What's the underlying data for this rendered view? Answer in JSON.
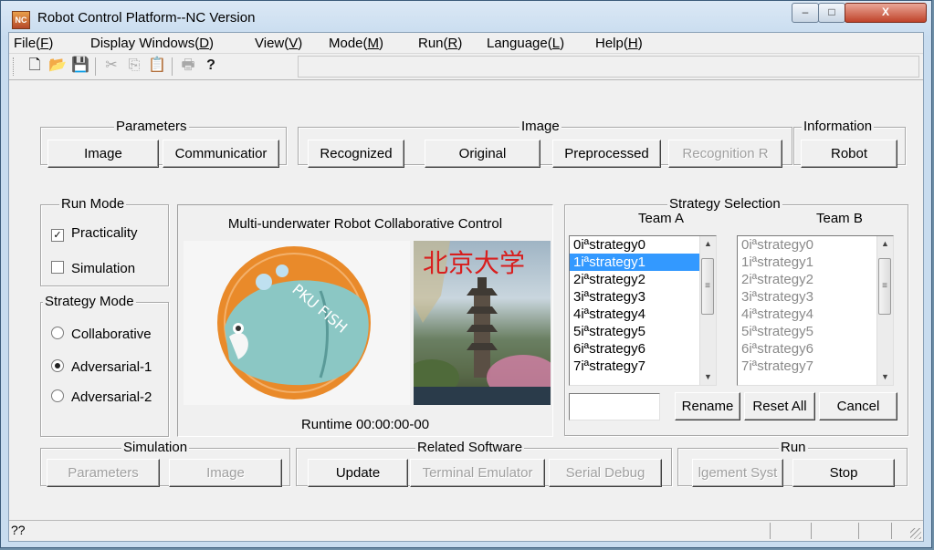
{
  "window": {
    "title": "Robot Control Platform--NC Version",
    "icon_text": "NC",
    "buttons": {
      "minimize": "–",
      "maximize": "□",
      "close": "X"
    }
  },
  "menu": [
    {
      "label": "File(",
      "key": "F"
    },
    {
      "label": "Display Windows(",
      "key": "D"
    },
    {
      "label": "View(",
      "key": "V"
    },
    {
      "label": "Mode(",
      "key": "M"
    },
    {
      "label": "Run(",
      "key": "R"
    },
    {
      "label": "Language(",
      "key": "L"
    },
    {
      "label": "Help(",
      "key": "H"
    }
  ],
  "toolbar": {
    "icons": [
      "new-icon",
      "open-icon",
      "save-icon",
      "cut-icon",
      "copy-icon",
      "paste-icon",
      "print-icon",
      "help-icon"
    ]
  },
  "parameters": {
    "label": "Parameters",
    "image_button": "Image",
    "communication_button": "Communicatior"
  },
  "image": {
    "label": "Image",
    "recognized_button": "Recognized",
    "original_button": "Original",
    "preprocessed_button": "Preprocessed",
    "recognition_button": "Recognition R"
  },
  "information": {
    "label": "Information",
    "robot_button": "Robot"
  },
  "run_mode": {
    "label": "Run Mode",
    "practicality": "Practicality",
    "practicality_checked": true,
    "simulation": "Simulation",
    "simulation_checked": false
  },
  "strategy_mode": {
    "label": "Strategy Mode",
    "options": [
      "Collaborative",
      "Adversarial-1",
      "Adversarial-2"
    ],
    "selected_index": 1
  },
  "display": {
    "title": "Multi-underwater Robot Collaborative Control",
    "logo_text": "PKU FISH",
    "photo_text": "北京大学",
    "runtime": "Runtime 00:00:00-00"
  },
  "strategy_selection": {
    "label": "Strategy Selection",
    "team_a_label": "Team A",
    "team_b_label": "Team B",
    "team_a_items": [
      "0iªstrategy0",
      "1iªstrategy1",
      "2iªstrategy2",
      "3iªstrategy3",
      "4iªstrategy4",
      "5iªstrategy5",
      "6iªstrategy6",
      "7iªstrategy7"
    ],
    "team_a_selected": 1,
    "team_b_items": [
      "0iªstrategy0",
      "1iªstrategy1",
      "2iªstrategy2",
      "3iªstrategy3",
      "4iªstrategy4",
      "5iªstrategy5",
      "6iªstrategy6",
      "7iªstrategy7"
    ],
    "rename_input": "",
    "rename_button": "Rename",
    "reset_all_button": "Reset All",
    "cancel_button": "Cancel"
  },
  "simulation": {
    "label": "Simulation",
    "parameters_button": "Parameters",
    "image_button": "Image"
  },
  "related_software": {
    "label": "Related Software",
    "update_button": "Update",
    "terminal_button": "Terminal Emulator",
    "serial_button": "Serial Debug"
  },
  "run": {
    "label": "Run",
    "management_button": "lgement Syst",
    "stop_button": "Stop"
  },
  "status_bar": {
    "text": "??"
  }
}
